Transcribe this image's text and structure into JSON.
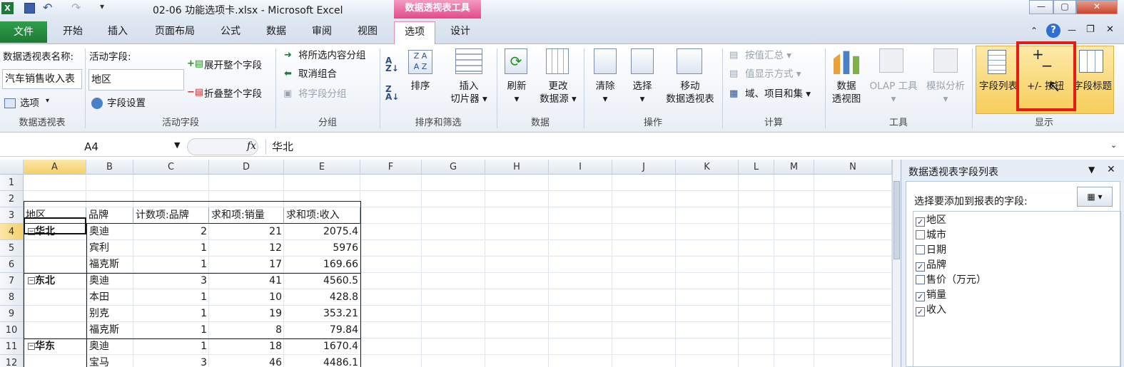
{
  "window": {
    "title": "02-06 功能选项卡.xlsx  -  Microsoft Excel",
    "context_tab": "数据透视表工具",
    "min": "▭",
    "restore": "▫",
    "close": "✕"
  },
  "tabs": {
    "file": "文件",
    "items": [
      "开始",
      "插入",
      "页面布局",
      "公式",
      "数据",
      "审阅",
      "视图",
      "选项",
      "设计"
    ],
    "active": "选项"
  },
  "ribbon": {
    "pivot": {
      "name_label": "数据透视表名称:",
      "name_value": "汽车销售收入表",
      "options": "选项",
      "group": "数据透视表"
    },
    "active_field": {
      "label": "活动字段:",
      "value": "地区",
      "field_settings": "字段设置",
      "expand": "展开整个字段",
      "collapse": "折叠整个字段",
      "group": "活动字段"
    },
    "grouping": {
      "group_sel": "将所选内容分组",
      "ungroup": "取消组合",
      "group_field": "将字段分组",
      "group": "分组"
    },
    "sort": {
      "sort": "排序",
      "slicer_line1": "插入",
      "slicer_line2": "切片器",
      "group": "排序和筛选"
    },
    "data": {
      "refresh": "刷新",
      "change_l1": "更改",
      "change_l2": "数据源",
      "group": "数据"
    },
    "actions": {
      "clear": "清除",
      "select": "选择",
      "move_l1": "移动",
      "move_l2": "数据透视表",
      "group": "操作"
    },
    "calc": {
      "summarize": "按值汇总",
      "show_as": "值显示方式",
      "fields_items": "域、项目和集",
      "group": "计算"
    },
    "tools": {
      "chart_l1": "数据",
      "chart_l2": "透视图",
      "olap": "OLAP 工具",
      "whatif": "模拟分析",
      "group": "工具"
    },
    "show": {
      "field_list": "字段列表",
      "buttons": "+/- 按钮",
      "headers": "字段标题",
      "group": "显示"
    }
  },
  "formula": {
    "namebox": "A4",
    "fx": "fx",
    "value": "华北"
  },
  "columns": [
    "A",
    "B",
    "C",
    "D",
    "E",
    "F",
    "G",
    "H",
    "I",
    "J",
    "K",
    "L",
    "M",
    "N"
  ],
  "rows": [
    "1",
    "2",
    "3",
    "4",
    "5",
    "6",
    "7",
    "8",
    "9",
    "10",
    "11",
    "12"
  ],
  "pivot": {
    "headers": [
      "地区",
      "品牌",
      "计数项:品牌",
      "求和项:销量",
      "求和项:收入"
    ],
    "rows": [
      {
        "region": "华北",
        "brand": "奥迪",
        "count": "2",
        "qty": "21",
        "rev": "2075.4"
      },
      {
        "region": "",
        "brand": "宾利",
        "count": "1",
        "qty": "12",
        "rev": "5976"
      },
      {
        "region": "",
        "brand": "福克斯",
        "count": "1",
        "qty": "17",
        "rev": "169.66"
      },
      {
        "region": "东北",
        "brand": "奥迪",
        "count": "3",
        "qty": "41",
        "rev": "4560.5"
      },
      {
        "region": "",
        "brand": "本田",
        "count": "1",
        "qty": "10",
        "rev": "428.8"
      },
      {
        "region": "",
        "brand": "别克",
        "count": "1",
        "qty": "19",
        "rev": "353.21"
      },
      {
        "region": "",
        "brand": "福克斯",
        "count": "1",
        "qty": "8",
        "rev": "79.84"
      },
      {
        "region": "华东",
        "brand": "奥迪",
        "count": "1",
        "qty": "18",
        "rev": "1670.4"
      },
      {
        "region": "",
        "brand": "宝马",
        "count": "3",
        "qty": "46",
        "rev": "4486.1"
      }
    ]
  },
  "fieldpane": {
    "title": "数据透视表字段列表",
    "prompt": "选择要添加到报表的字段:",
    "fields": [
      {
        "name": "地区",
        "checked": true
      },
      {
        "name": "城市",
        "checked": false
      },
      {
        "name": "日期",
        "checked": false
      },
      {
        "name": "品牌",
        "checked": true
      },
      {
        "name": "售价（万元）",
        "checked": false
      },
      {
        "name": "销量",
        "checked": true
      },
      {
        "name": "收入",
        "checked": true
      }
    ]
  }
}
